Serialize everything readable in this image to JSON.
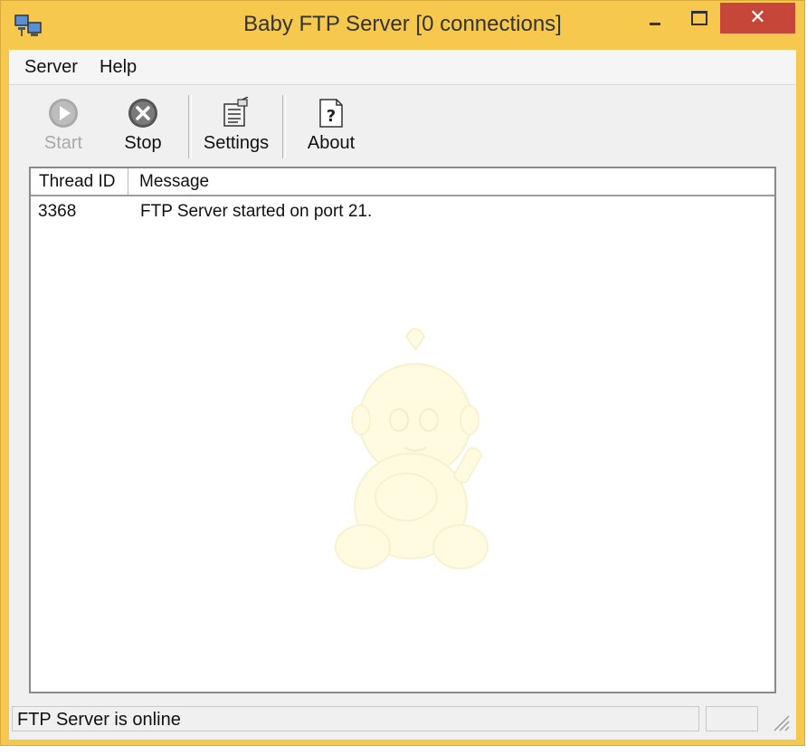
{
  "window": {
    "title": "Baby FTP Server [0 connections]",
    "accent_color": "#f6c94e",
    "close_color": "#c7463a",
    "icons": {
      "app": "network-computers-icon",
      "minimize": "minimize-icon",
      "maximize": "maximize-icon",
      "close": "close-icon",
      "close_glyph": "✕"
    }
  },
  "menu": {
    "items": [
      {
        "label": "Server"
      },
      {
        "label": "Help"
      }
    ]
  },
  "toolbar": {
    "buttons": [
      {
        "label": "Start",
        "icon": "play-icon",
        "enabled": false
      },
      {
        "label": "Stop",
        "icon": "stop-icon",
        "enabled": true
      },
      {
        "label": "Settings",
        "icon": "settings-icon",
        "enabled": true
      },
      {
        "label": "About",
        "icon": "about-help-icon",
        "enabled": true
      }
    ]
  },
  "log": {
    "columns": [
      "Thread ID",
      "Message"
    ],
    "rows": [
      {
        "thread_id": "3368",
        "message": "FTP Server started on port 21."
      }
    ],
    "watermark_icon": "baby-watermark-icon"
  },
  "status": {
    "text": "FTP Server is online",
    "grip_icon": "resize-grip-icon"
  }
}
